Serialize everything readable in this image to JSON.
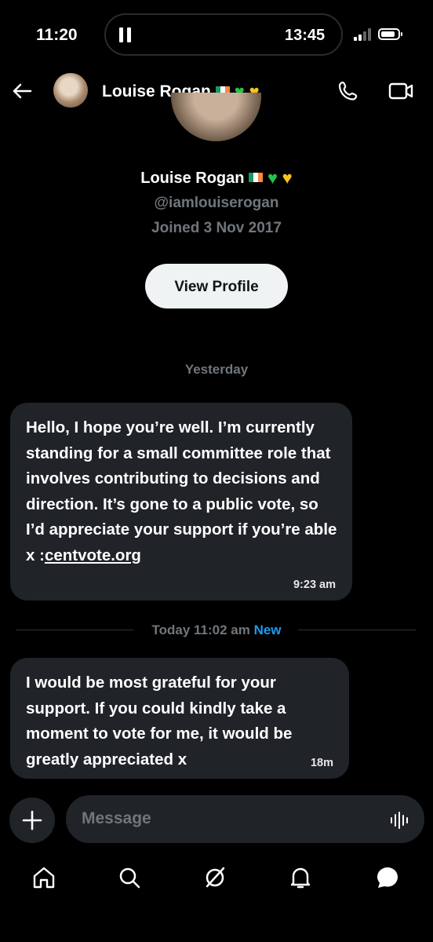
{
  "status_bar": {
    "time_left": "11:20",
    "time_right": "13:45"
  },
  "header": {
    "name": "Louise Rogan",
    "back_icon": "arrow-left-icon",
    "call_icon": "phone-icon",
    "video_icon": "video-camera-icon"
  },
  "profile": {
    "name": "Louise Rogan",
    "handle": "@iamlouiserogan",
    "joined": "Joined 3 Nov 2017",
    "view_button": "View Profile"
  },
  "conversation": {
    "day_label": "Yesterday",
    "messages": [
      {
        "text": "Hello, I hope you’re well. I’m currently standing for a small committee role that involves contributing to decisions and direction. It’s gone to a public vote, so I’d appreciate your support if you’re able x :",
        "link": "centvote.org",
        "time": "9:23 am"
      },
      {
        "text": "I would be most grateful for your support. If you could kindly take a moment to vote for me, it would be greatly appreciated x",
        "time": "18m"
      }
    ],
    "separator": {
      "label": "Today 11:02 am",
      "badge": "New"
    }
  },
  "composer": {
    "placeholder": "Message"
  },
  "nav": [
    "home-icon",
    "search-icon",
    "grok-icon",
    "notifications-icon",
    "messages-icon"
  ],
  "colors": {
    "background": "#000000",
    "bubble": "#202327",
    "accent": "#1d9bf0",
    "muted": "#71767b"
  }
}
